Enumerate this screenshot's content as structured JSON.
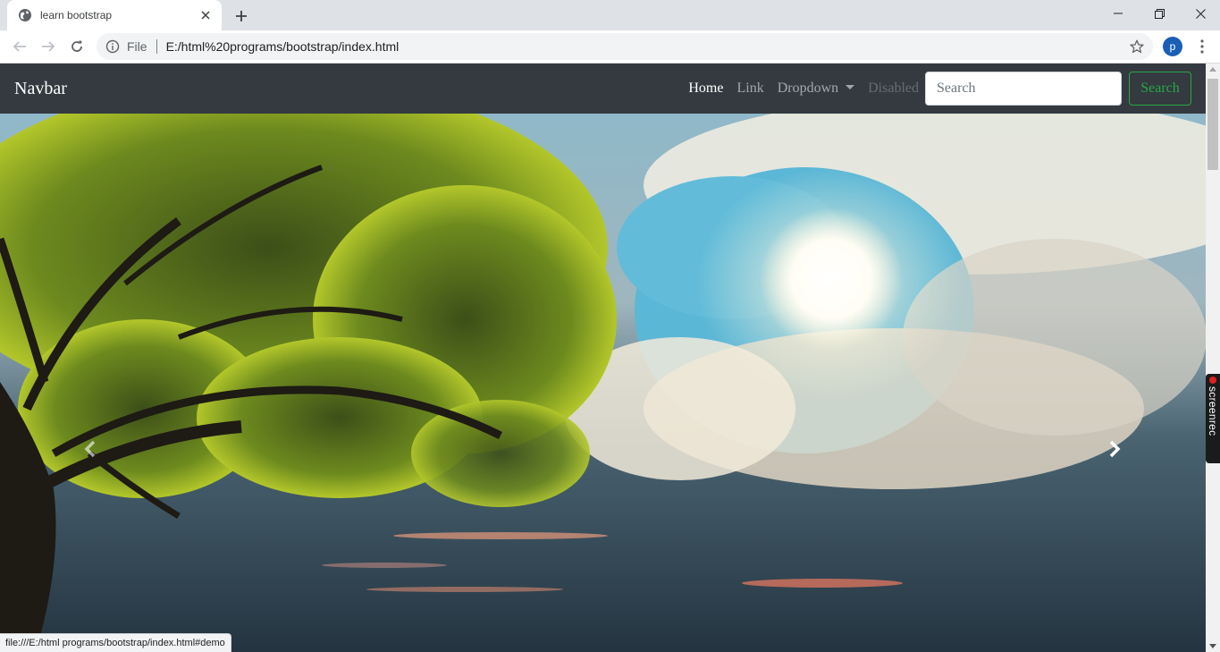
{
  "browser": {
    "tab_title": "learn bootstrap",
    "scheme_label": "File",
    "url": "E:/html%20programs/bootstrap/index.html",
    "profile_initial": "p",
    "status_url": "file:///E:/html programs/bootstrap/index.html#demo"
  },
  "navbar": {
    "brand": "Navbar",
    "links": [
      {
        "label": "Home",
        "state": "active"
      },
      {
        "label": "Link",
        "state": "normal"
      },
      {
        "label": "Dropdown",
        "state": "dropdown"
      },
      {
        "label": "Disabled",
        "state": "disabled"
      }
    ],
    "search_placeholder": "Search",
    "search_button": "Search"
  },
  "carousel": {
    "image": "tree-sky-sun"
  },
  "overlay": {
    "recorder_label": "screenrec"
  },
  "colors": {
    "navbar_bg": "#343a40",
    "search_outline": "#28a745",
    "profile": "#1a5fb4"
  }
}
